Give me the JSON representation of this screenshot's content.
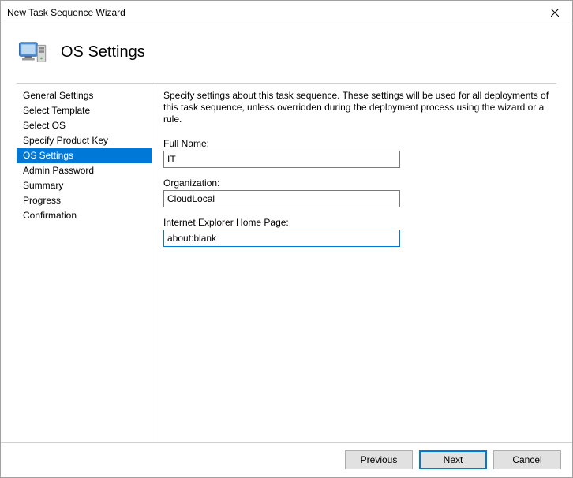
{
  "window": {
    "title": "New Task Sequence Wizard"
  },
  "header": {
    "title": "OS Settings"
  },
  "sidebar": {
    "items": [
      {
        "label": "General Settings",
        "selected": false
      },
      {
        "label": "Select Template",
        "selected": false
      },
      {
        "label": "Select OS",
        "selected": false
      },
      {
        "label": "Specify Product Key",
        "selected": false
      },
      {
        "label": "OS Settings",
        "selected": true
      },
      {
        "label": "Admin Password",
        "selected": false
      },
      {
        "label": "Summary",
        "selected": false
      },
      {
        "label": "Progress",
        "selected": false
      },
      {
        "label": "Confirmation",
        "selected": false
      }
    ]
  },
  "main": {
    "description": "Specify settings about this task sequence.  These settings will be used for all deployments of this task sequence, unless overridden during the deployment process using the wizard or a rule.",
    "fields": {
      "fullname": {
        "label": "Full Name:",
        "value": "IT"
      },
      "organization": {
        "label": "Organization:",
        "value": "CloudLocal"
      },
      "homepage": {
        "label": "Internet Explorer Home Page:",
        "value": "about:blank"
      }
    }
  },
  "footer": {
    "previous": "Previous",
    "next": "Next",
    "cancel": "Cancel"
  }
}
